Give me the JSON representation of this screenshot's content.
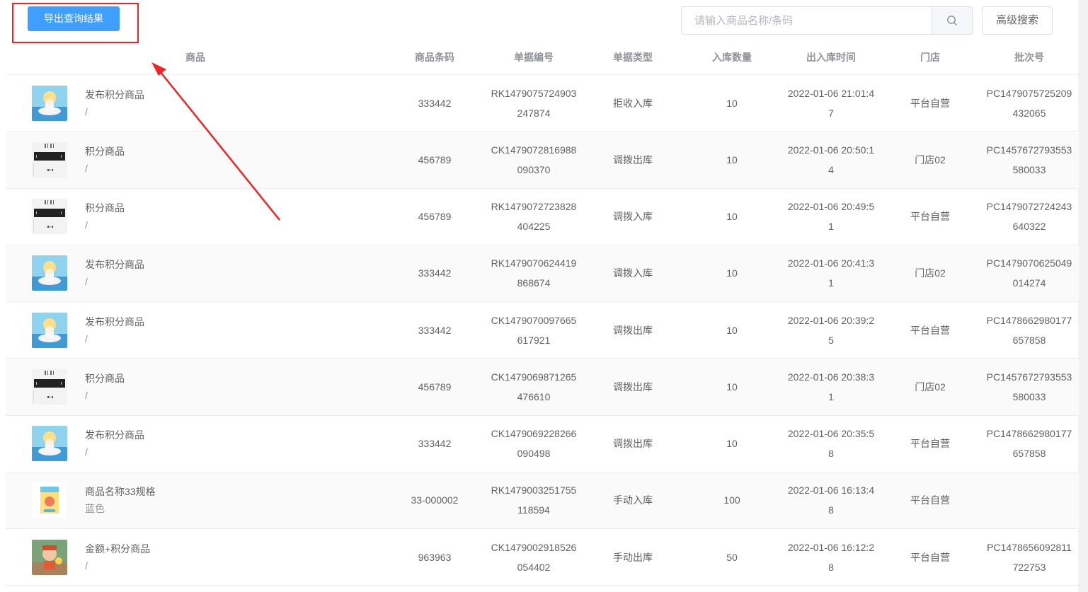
{
  "toolbar": {
    "export_label": "导出查询结果",
    "search_placeholder": "请输入商品名称/条码",
    "search_value": "",
    "advanced_label": "高级搜索"
  },
  "table": {
    "headers": {
      "goods": "商品",
      "barcode": "商品条码",
      "doc_no": "单据编号",
      "doc_type": "单据类型",
      "qty": "入库数量",
      "time": "出入库时间",
      "store": "门店",
      "batch": "批次号"
    },
    "rows": [
      {
        "thumb": "figure-pool",
        "name": "发布积分商品",
        "spec": "/",
        "barcode": "333442",
        "doc_no": "RK1479075724903247874",
        "doc_type": "拒收入库",
        "qty": "10",
        "time": "2022-01-06 21:01:47",
        "store": "平台自营",
        "batch": "PC1479075725209432065"
      },
      {
        "thumb": "barcode",
        "name": "积分商品",
        "spec": "/",
        "barcode": "456789",
        "doc_no": "CK1479072816988090370",
        "doc_type": "调拨出库",
        "qty": "10",
        "time": "2022-01-06 20:50:14",
        "store": "门店02",
        "batch": "PC1457672793553580033"
      },
      {
        "thumb": "barcode",
        "name": "积分商品",
        "spec": "/",
        "barcode": "456789",
        "doc_no": "RK1479072723828404225",
        "doc_type": "调拨入库",
        "qty": "10",
        "time": "2022-01-06 20:49:51",
        "store": "平台自营",
        "batch": "PC1479072724243640322"
      },
      {
        "thumb": "figure-pool",
        "name": "发布积分商品",
        "spec": "/",
        "barcode": "333442",
        "doc_no": "RK1479070624419868674",
        "doc_type": "调拨入库",
        "qty": "10",
        "time": "2022-01-06 20:41:31",
        "store": "门店02",
        "batch": "PC1479070625049014274"
      },
      {
        "thumb": "figure-pool",
        "name": "发布积分商品",
        "spec": "/",
        "barcode": "333442",
        "doc_no": "CK1479070097665617921",
        "doc_type": "调拨出库",
        "qty": "10",
        "time": "2022-01-06 20:39:25",
        "store": "平台自营",
        "batch": "PC1478662980177657858"
      },
      {
        "thumb": "barcode",
        "name": "积分商品",
        "spec": "/",
        "barcode": "456789",
        "doc_no": "CK1479069871265476610",
        "doc_type": "调拨出库",
        "qty": "10",
        "time": "2022-01-06 20:38:31",
        "store": "门店02",
        "batch": "PC1457672793553580033"
      },
      {
        "thumb": "figure-pool",
        "name": "发布积分商品",
        "spec": "/",
        "barcode": "333442",
        "doc_no": "CK1479069228266090498",
        "doc_type": "调拨出库",
        "qty": "10",
        "time": "2022-01-06 20:35:58",
        "store": "平台自营",
        "batch": "PC1478662980177657858"
      },
      {
        "thumb": "box",
        "name": "商品名称33规格",
        "spec": "蓝色",
        "barcode": "33-000002",
        "doc_no": "RK1479003251755118594",
        "doc_type": "手动入库",
        "qty": "100",
        "time": "2022-01-06 16:13:48",
        "store": "平台自营",
        "batch": ""
      },
      {
        "thumb": "figure-red",
        "name": "金额+积分商品",
        "spec": "/",
        "barcode": "963963",
        "doc_no": "CK1479002918526054402",
        "doc_type": "手动出库",
        "qty": "50",
        "time": "2022-01-06 16:12:28",
        "store": "平台自营",
        "batch": "PC1478656092811722753"
      }
    ]
  },
  "colors": {
    "primary": "#409eff",
    "annotation_red": "#f02424",
    "header_text": "#909399",
    "body_text": "#606266"
  }
}
